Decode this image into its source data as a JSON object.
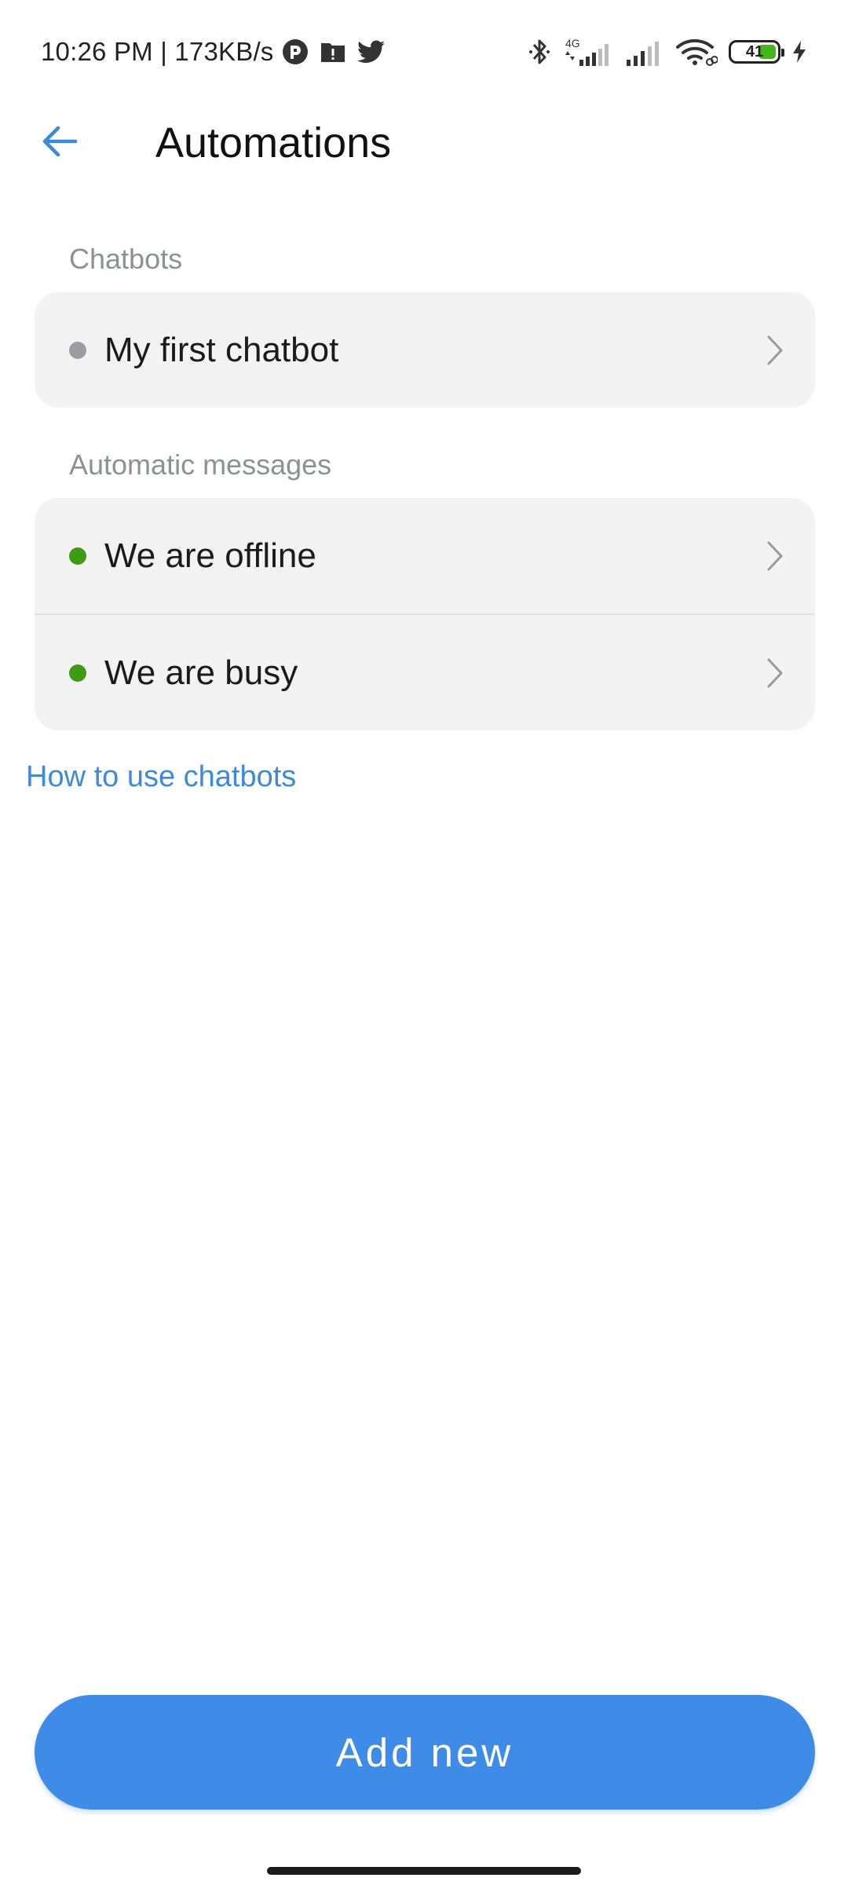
{
  "status_bar": {
    "time_and_speed": "10:26 PM | 173KB/s",
    "app_icons": [
      "pocketcasts-icon",
      "google-drive-alert-icon",
      "twitter-icon"
    ],
    "network_type": "4G",
    "battery_level": "41",
    "battery_fraction": 0.41,
    "charging": true
  },
  "app_bar": {
    "back_icon": "arrow-left-icon",
    "title": "Automations"
  },
  "sections": {
    "chatbots": {
      "header": "Chatbots",
      "items": [
        {
          "label": "My first chatbot",
          "status_color": "#9b9ea1"
        }
      ]
    },
    "automatic_messages": {
      "header": "Automatic messages",
      "items": [
        {
          "label": "We are offline",
          "status_color": "#3f9b13"
        },
        {
          "label": "We are busy",
          "status_color": "#3f9b13"
        }
      ]
    }
  },
  "help_link": "How to use chatbots",
  "add_new_button": "Add new",
  "colors": {
    "accent": "#3f8be8",
    "link": "#3f8ad8",
    "active_dot": "#3f9b13",
    "inactive_dot": "#9b9ea1",
    "card_bg": "#f3f3f3"
  }
}
